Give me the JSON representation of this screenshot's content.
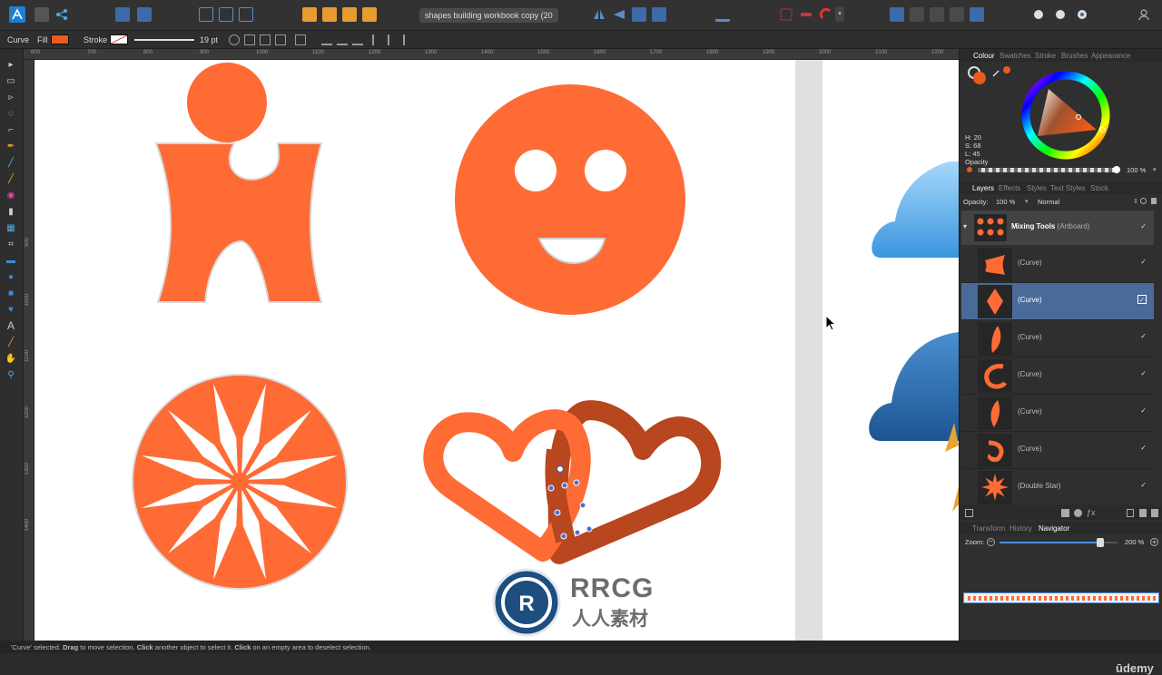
{
  "toolbar": {
    "document_title": "shapes building workbook copy (20"
  },
  "context": {
    "object_type": "Curve",
    "fill_label": "Fill",
    "stroke_label": "Stroke",
    "stroke_width": "19 pt",
    "fill_color": "#ea5a1c"
  },
  "ruler": {
    "top_ticks": [
      "600",
      "700",
      "800",
      "900",
      "1000",
      "1100",
      "1200",
      "1300",
      "1400",
      "1500",
      "1600",
      "1700",
      "1800",
      "1900",
      "2000",
      "2100",
      "2200"
    ],
    "left_ticks": [
      "900",
      "1000",
      "1100",
      "1200",
      "1300",
      "1400"
    ]
  },
  "colour_panel": {
    "tabs": [
      "Colour",
      "Swatches",
      "Stroke",
      "Brushes",
      "Appearance"
    ],
    "active_tab": "Colour",
    "h": "H: 20",
    "s": "S: 68",
    "l": "L: 45",
    "opacity_label": "Opacity",
    "opacity_value": "100 %"
  },
  "layers_panel": {
    "tabs": [
      "Layers",
      "Effects",
      "Styles",
      "Text Styles",
      "Stock"
    ],
    "active_tab": "Layers",
    "opacity_label": "Opacity:",
    "opacity_value": "100 %",
    "blend_mode": "Normal",
    "artboard_name": "Mixing Tools",
    "artboard_suffix": "(Artboard)",
    "layers": [
      {
        "name": "(Curve)",
        "icon": "curve-shape-1",
        "selected": false
      },
      {
        "name": "(Curve)",
        "icon": "curve-diamond",
        "selected": true
      },
      {
        "name": "(Curve)",
        "icon": "curve-leaf",
        "selected": false
      },
      {
        "name": "(Curve)",
        "icon": "curve-hook",
        "selected": false
      },
      {
        "name": "(Curve)",
        "icon": "curve-petal",
        "selected": false
      },
      {
        "name": "(Curve)",
        "icon": "curve-swirl",
        "selected": false
      },
      {
        "name": "(Double Star)",
        "icon": "double-star",
        "selected": false
      }
    ]
  },
  "transform_panel": {
    "tabs": [
      "Transform",
      "History",
      "Navigator"
    ],
    "active_tab": "Navigator",
    "zoom_label": "Zoom:",
    "zoom_value": "200 %",
    "zoom_level": 0.85
  },
  "status": {
    "part1": "'Curve' selected. ",
    "drag": "Drag",
    "part2": " to move selection. ",
    "click1": "Click",
    "part3": " another object to select it. ",
    "click2": "Click",
    "part4": " on an empty area to deselect selection."
  },
  "watermark": {
    "line1": "RRCG",
    "line2": "人人素材"
  },
  "branding": {
    "udemy": "ūdemy"
  },
  "colors": {
    "orange": "#ff6b35",
    "dark_orange": "#b8461f",
    "selection_blue": "#4a6b9a"
  }
}
